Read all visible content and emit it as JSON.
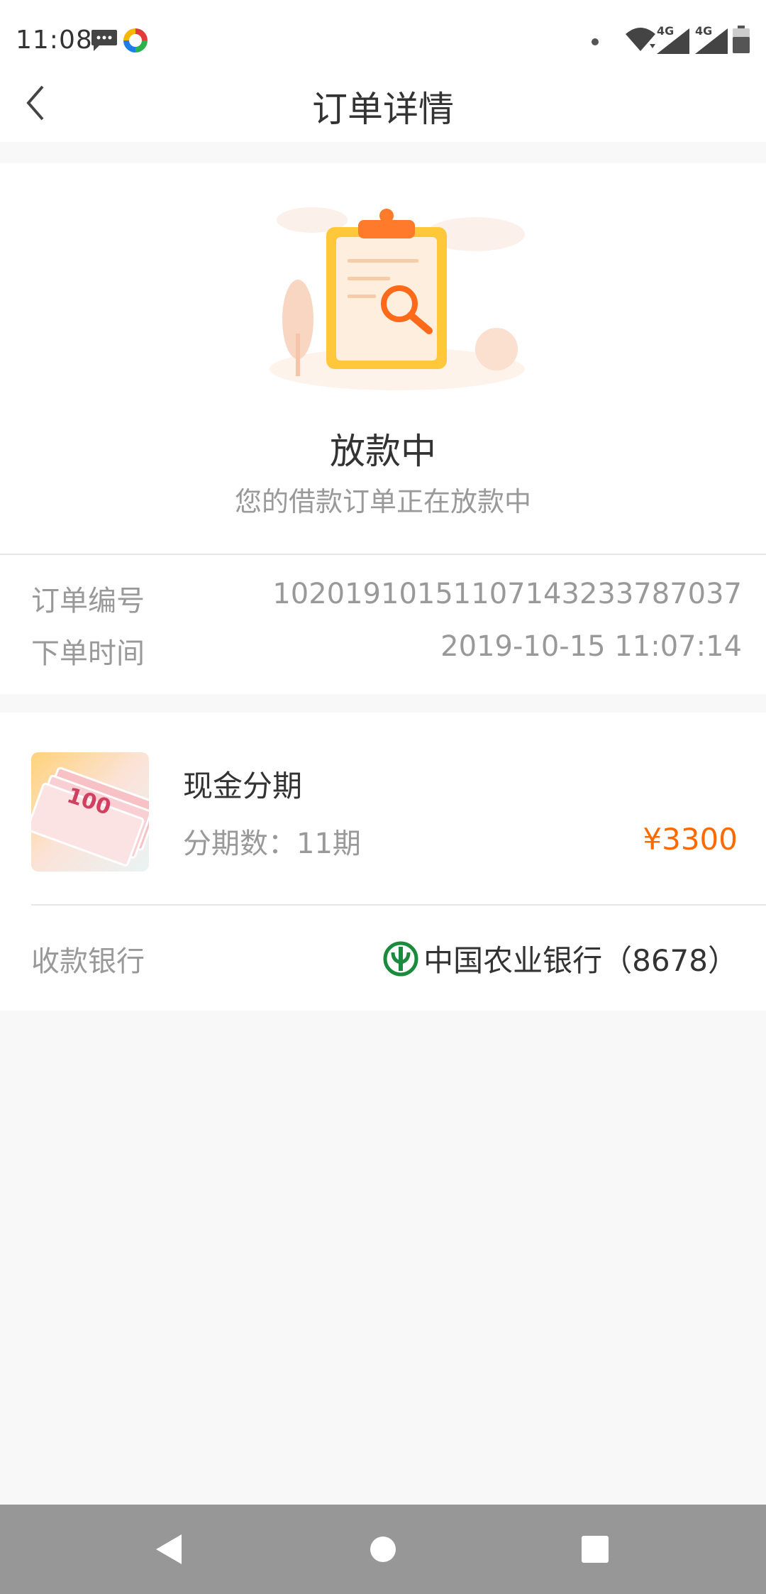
{
  "status_bar": {
    "time": "11:08",
    "network_label_1": "4G",
    "network_label_2": "4G",
    "icons": [
      "message-icon",
      "app-icon",
      "dot-icon",
      "wifi-icon",
      "signal-icon",
      "signal-icon",
      "battery-icon"
    ]
  },
  "header": {
    "title": "订单详情",
    "back_icon": "chevron-left-icon"
  },
  "status": {
    "title": "放款中",
    "description": "您的借款订单正在放款中",
    "illustration": "clipboard-magnifier-illustration"
  },
  "order_info": {
    "rows": [
      {
        "label": "订单编号",
        "value": "10201910151107143233787037"
      },
      {
        "label": "下单时间",
        "value": "2019-10-15 11:07:14"
      }
    ]
  },
  "product": {
    "name": "现金分期",
    "installments": "分期数：11期",
    "price": "¥3300",
    "thumb_text": "100",
    "bank_label": "收款银行",
    "bank_name": "中国农业银行（8678）",
    "bank_icon": "abc-bank-icon"
  },
  "colors": {
    "accent": "#ff6a00",
    "primary_text": "#333333",
    "secondary_text": "#999999",
    "bank_green": "#1a8a3c"
  },
  "system_nav": {
    "icons": [
      "back-triangle-icon",
      "home-circle-icon",
      "recent-square-icon"
    ]
  }
}
